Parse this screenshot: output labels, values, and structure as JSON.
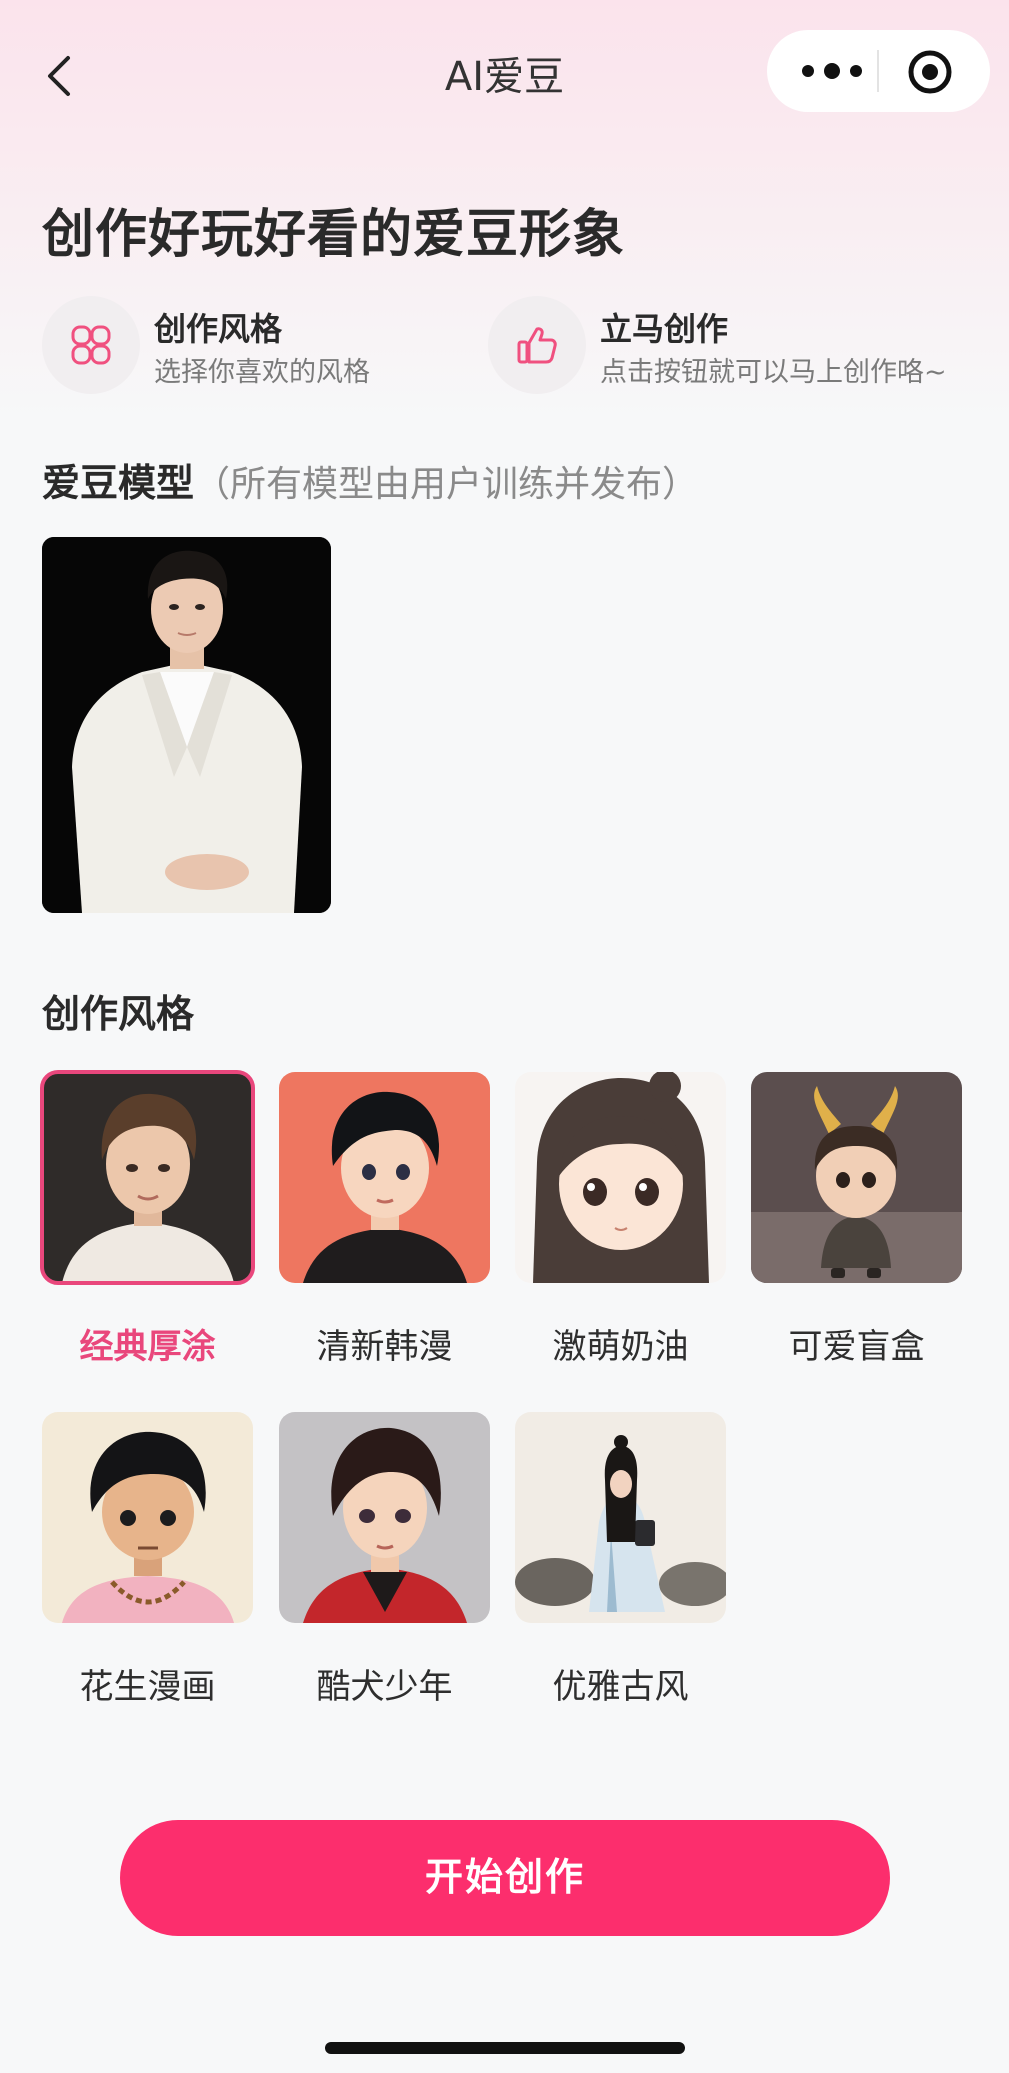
{
  "nav": {
    "title": "AI爱豆"
  },
  "headline": "创作好玩好看的爱豆形象",
  "features": [
    {
      "title": "创作风格",
      "subtitle": "选择你喜欢的风格",
      "icon": "four-petal-icon"
    },
    {
      "title": "立马创作",
      "subtitle": "点击按钮就可以马上创作咯~",
      "icon": "thumbs-up-icon"
    }
  ],
  "model_section": {
    "title": "爱豆模型",
    "subtitle": "（所有模型由用户训练并发布）"
  },
  "style_section": {
    "title": "创作风格",
    "items": [
      {
        "label": "经典厚涂",
        "selected": true
      },
      {
        "label": "清新韩漫",
        "selected": false
      },
      {
        "label": "激萌奶油",
        "selected": false
      },
      {
        "label": "可爱盲盒",
        "selected": false
      },
      {
        "label": "花生漫画",
        "selected": false
      },
      {
        "label": "酷犬少年",
        "selected": false
      },
      {
        "label": "优雅古风",
        "selected": false
      }
    ]
  },
  "start_button": "开始创作",
  "colors": {
    "accent": "#fc2e6d",
    "selected": "#e9477c"
  }
}
